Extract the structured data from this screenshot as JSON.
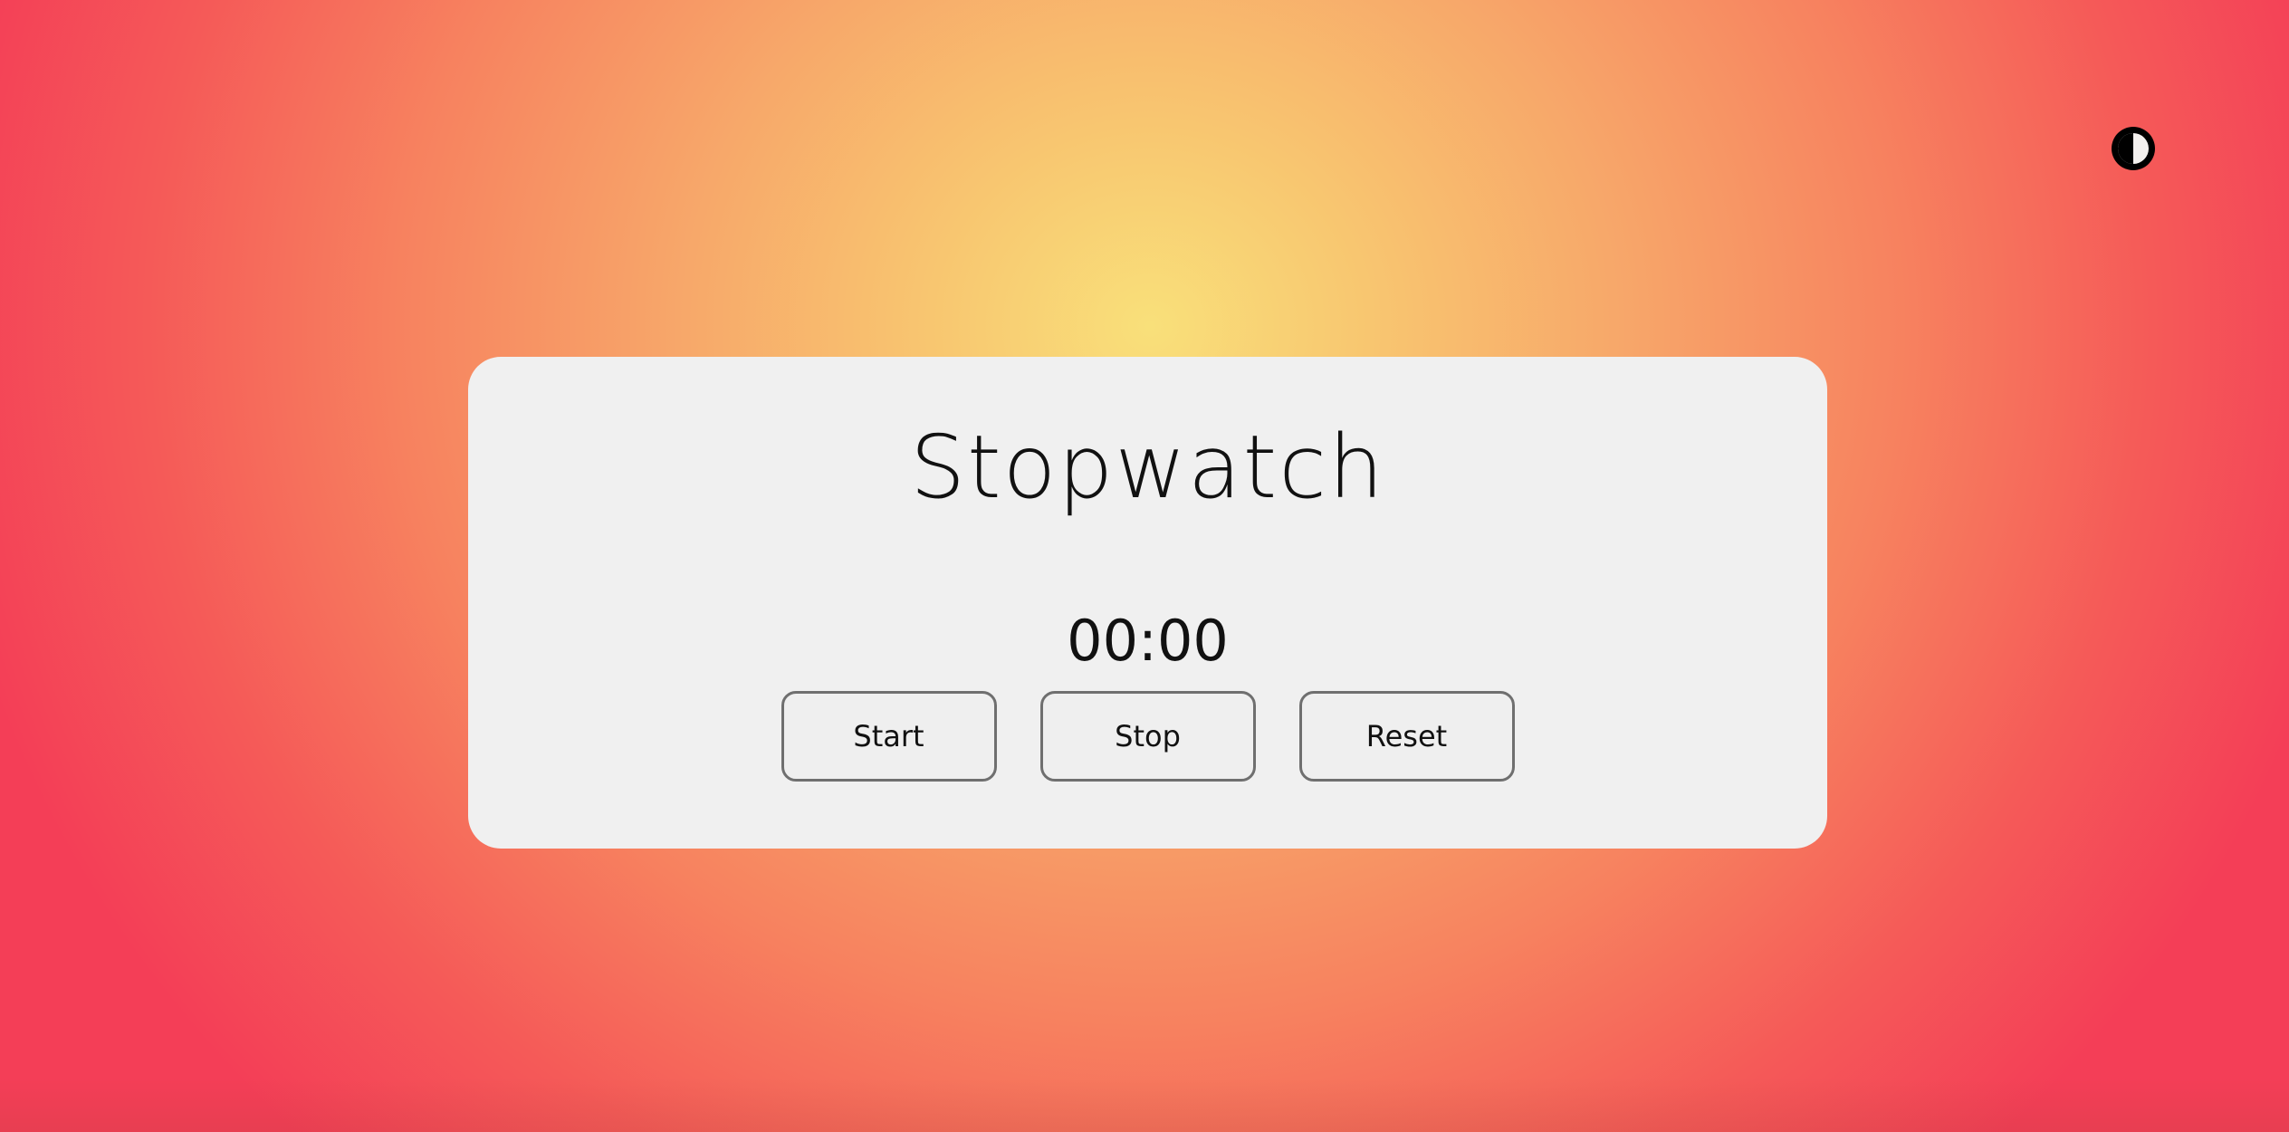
{
  "app": {
    "title": "Stopwatch",
    "time": "00:00"
  },
  "controls": {
    "start_label": "Start",
    "stop_label": "Stop",
    "reset_label": "Reset"
  },
  "theme_toggle": {
    "icon": "contrast-icon"
  },
  "colors": {
    "background_center": "#f9e07a",
    "background_edge": "#f43e57",
    "card_background": "#f0f0f0",
    "button_border": "#6f6f6f",
    "text": "#111111"
  }
}
